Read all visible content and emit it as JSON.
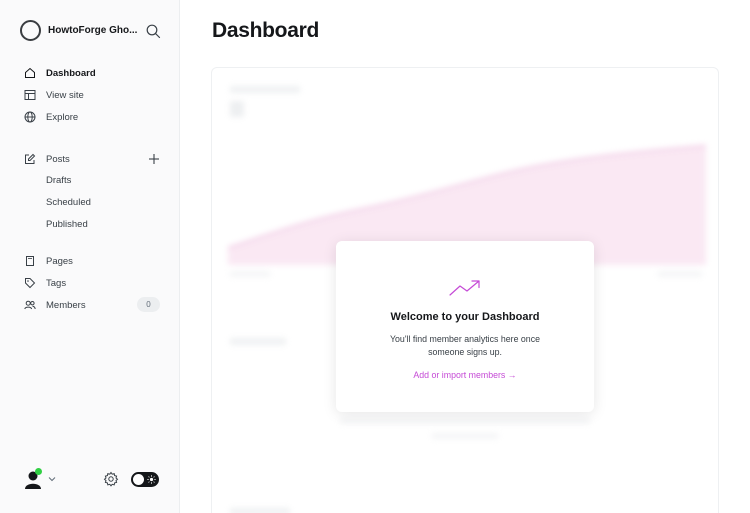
{
  "brand": {
    "name": "HowtoForge Gho..."
  },
  "nav": {
    "dashboard": "Dashboard",
    "view_site": "View site",
    "explore": "Explore",
    "posts": "Posts",
    "drafts": "Drafts",
    "scheduled": "Scheduled",
    "published": "Published",
    "pages": "Pages",
    "tags": "Tags",
    "members": "Members",
    "members_count": "0"
  },
  "page": {
    "title": "Dashboard"
  },
  "welcome": {
    "title": "Welcome to your Dashboard",
    "text": "You'll find member analytics here once someone signs up.",
    "link": "Add or import members →"
  },
  "colors": {
    "accent": "#c54ad6",
    "online": "#30cf43",
    "text": "#15171a"
  },
  "icons": [
    "ghost-logo-icon",
    "search-icon",
    "home-icon",
    "view-site-icon",
    "globe-icon",
    "edit-icon",
    "plus-icon",
    "page-icon",
    "tag-icon",
    "members-icon",
    "user-avatar-icon",
    "chevron-down-icon",
    "gear-icon",
    "sun-icon",
    "trending-up-icon"
  ]
}
